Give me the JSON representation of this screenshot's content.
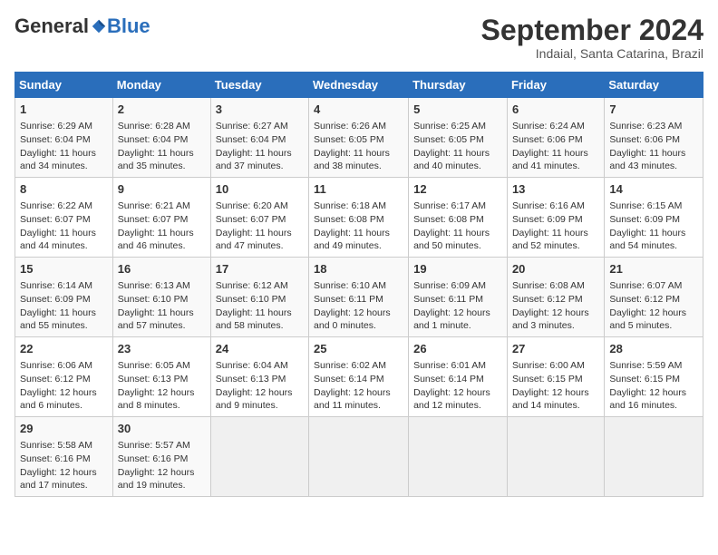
{
  "header": {
    "logo_general": "General",
    "logo_blue": "Blue",
    "month_title": "September 2024",
    "subtitle": "Indaial, Santa Catarina, Brazil"
  },
  "days_of_week": [
    "Sunday",
    "Monday",
    "Tuesday",
    "Wednesday",
    "Thursday",
    "Friday",
    "Saturday"
  ],
  "weeks": [
    [
      {
        "day": "1",
        "info": "Sunrise: 6:29 AM\nSunset: 6:04 PM\nDaylight: 11 hours\nand 34 minutes."
      },
      {
        "day": "2",
        "info": "Sunrise: 6:28 AM\nSunset: 6:04 PM\nDaylight: 11 hours\nand 35 minutes."
      },
      {
        "day": "3",
        "info": "Sunrise: 6:27 AM\nSunset: 6:04 PM\nDaylight: 11 hours\nand 37 minutes."
      },
      {
        "day": "4",
        "info": "Sunrise: 6:26 AM\nSunset: 6:05 PM\nDaylight: 11 hours\nand 38 minutes."
      },
      {
        "day": "5",
        "info": "Sunrise: 6:25 AM\nSunset: 6:05 PM\nDaylight: 11 hours\nand 40 minutes."
      },
      {
        "day": "6",
        "info": "Sunrise: 6:24 AM\nSunset: 6:06 PM\nDaylight: 11 hours\nand 41 minutes."
      },
      {
        "day": "7",
        "info": "Sunrise: 6:23 AM\nSunset: 6:06 PM\nDaylight: 11 hours\nand 43 minutes."
      }
    ],
    [
      {
        "day": "8",
        "info": "Sunrise: 6:22 AM\nSunset: 6:07 PM\nDaylight: 11 hours\nand 44 minutes."
      },
      {
        "day": "9",
        "info": "Sunrise: 6:21 AM\nSunset: 6:07 PM\nDaylight: 11 hours\nand 46 minutes."
      },
      {
        "day": "10",
        "info": "Sunrise: 6:20 AM\nSunset: 6:07 PM\nDaylight: 11 hours\nand 47 minutes."
      },
      {
        "day": "11",
        "info": "Sunrise: 6:18 AM\nSunset: 6:08 PM\nDaylight: 11 hours\nand 49 minutes."
      },
      {
        "day": "12",
        "info": "Sunrise: 6:17 AM\nSunset: 6:08 PM\nDaylight: 11 hours\nand 50 minutes."
      },
      {
        "day": "13",
        "info": "Sunrise: 6:16 AM\nSunset: 6:09 PM\nDaylight: 11 hours\nand 52 minutes."
      },
      {
        "day": "14",
        "info": "Sunrise: 6:15 AM\nSunset: 6:09 PM\nDaylight: 11 hours\nand 54 minutes."
      }
    ],
    [
      {
        "day": "15",
        "info": "Sunrise: 6:14 AM\nSunset: 6:09 PM\nDaylight: 11 hours\nand 55 minutes."
      },
      {
        "day": "16",
        "info": "Sunrise: 6:13 AM\nSunset: 6:10 PM\nDaylight: 11 hours\nand 57 minutes."
      },
      {
        "day": "17",
        "info": "Sunrise: 6:12 AM\nSunset: 6:10 PM\nDaylight: 11 hours\nand 58 minutes."
      },
      {
        "day": "18",
        "info": "Sunrise: 6:10 AM\nSunset: 6:11 PM\nDaylight: 12 hours\nand 0 minutes."
      },
      {
        "day": "19",
        "info": "Sunrise: 6:09 AM\nSunset: 6:11 PM\nDaylight: 12 hours\nand 1 minute."
      },
      {
        "day": "20",
        "info": "Sunrise: 6:08 AM\nSunset: 6:12 PM\nDaylight: 12 hours\nand 3 minutes."
      },
      {
        "day": "21",
        "info": "Sunrise: 6:07 AM\nSunset: 6:12 PM\nDaylight: 12 hours\nand 5 minutes."
      }
    ],
    [
      {
        "day": "22",
        "info": "Sunrise: 6:06 AM\nSunset: 6:12 PM\nDaylight: 12 hours\nand 6 minutes."
      },
      {
        "day": "23",
        "info": "Sunrise: 6:05 AM\nSunset: 6:13 PM\nDaylight: 12 hours\nand 8 minutes."
      },
      {
        "day": "24",
        "info": "Sunrise: 6:04 AM\nSunset: 6:13 PM\nDaylight: 12 hours\nand 9 minutes."
      },
      {
        "day": "25",
        "info": "Sunrise: 6:02 AM\nSunset: 6:14 PM\nDaylight: 12 hours\nand 11 minutes."
      },
      {
        "day": "26",
        "info": "Sunrise: 6:01 AM\nSunset: 6:14 PM\nDaylight: 12 hours\nand 12 minutes."
      },
      {
        "day": "27",
        "info": "Sunrise: 6:00 AM\nSunset: 6:15 PM\nDaylight: 12 hours\nand 14 minutes."
      },
      {
        "day": "28",
        "info": "Sunrise: 5:59 AM\nSunset: 6:15 PM\nDaylight: 12 hours\nand 16 minutes."
      }
    ],
    [
      {
        "day": "29",
        "info": "Sunrise: 5:58 AM\nSunset: 6:16 PM\nDaylight: 12 hours\nand 17 minutes."
      },
      {
        "day": "30",
        "info": "Sunrise: 5:57 AM\nSunset: 6:16 PM\nDaylight: 12 hours\nand 19 minutes."
      },
      {
        "day": "",
        "info": ""
      },
      {
        "day": "",
        "info": ""
      },
      {
        "day": "",
        "info": ""
      },
      {
        "day": "",
        "info": ""
      },
      {
        "day": "",
        "info": ""
      }
    ]
  ]
}
